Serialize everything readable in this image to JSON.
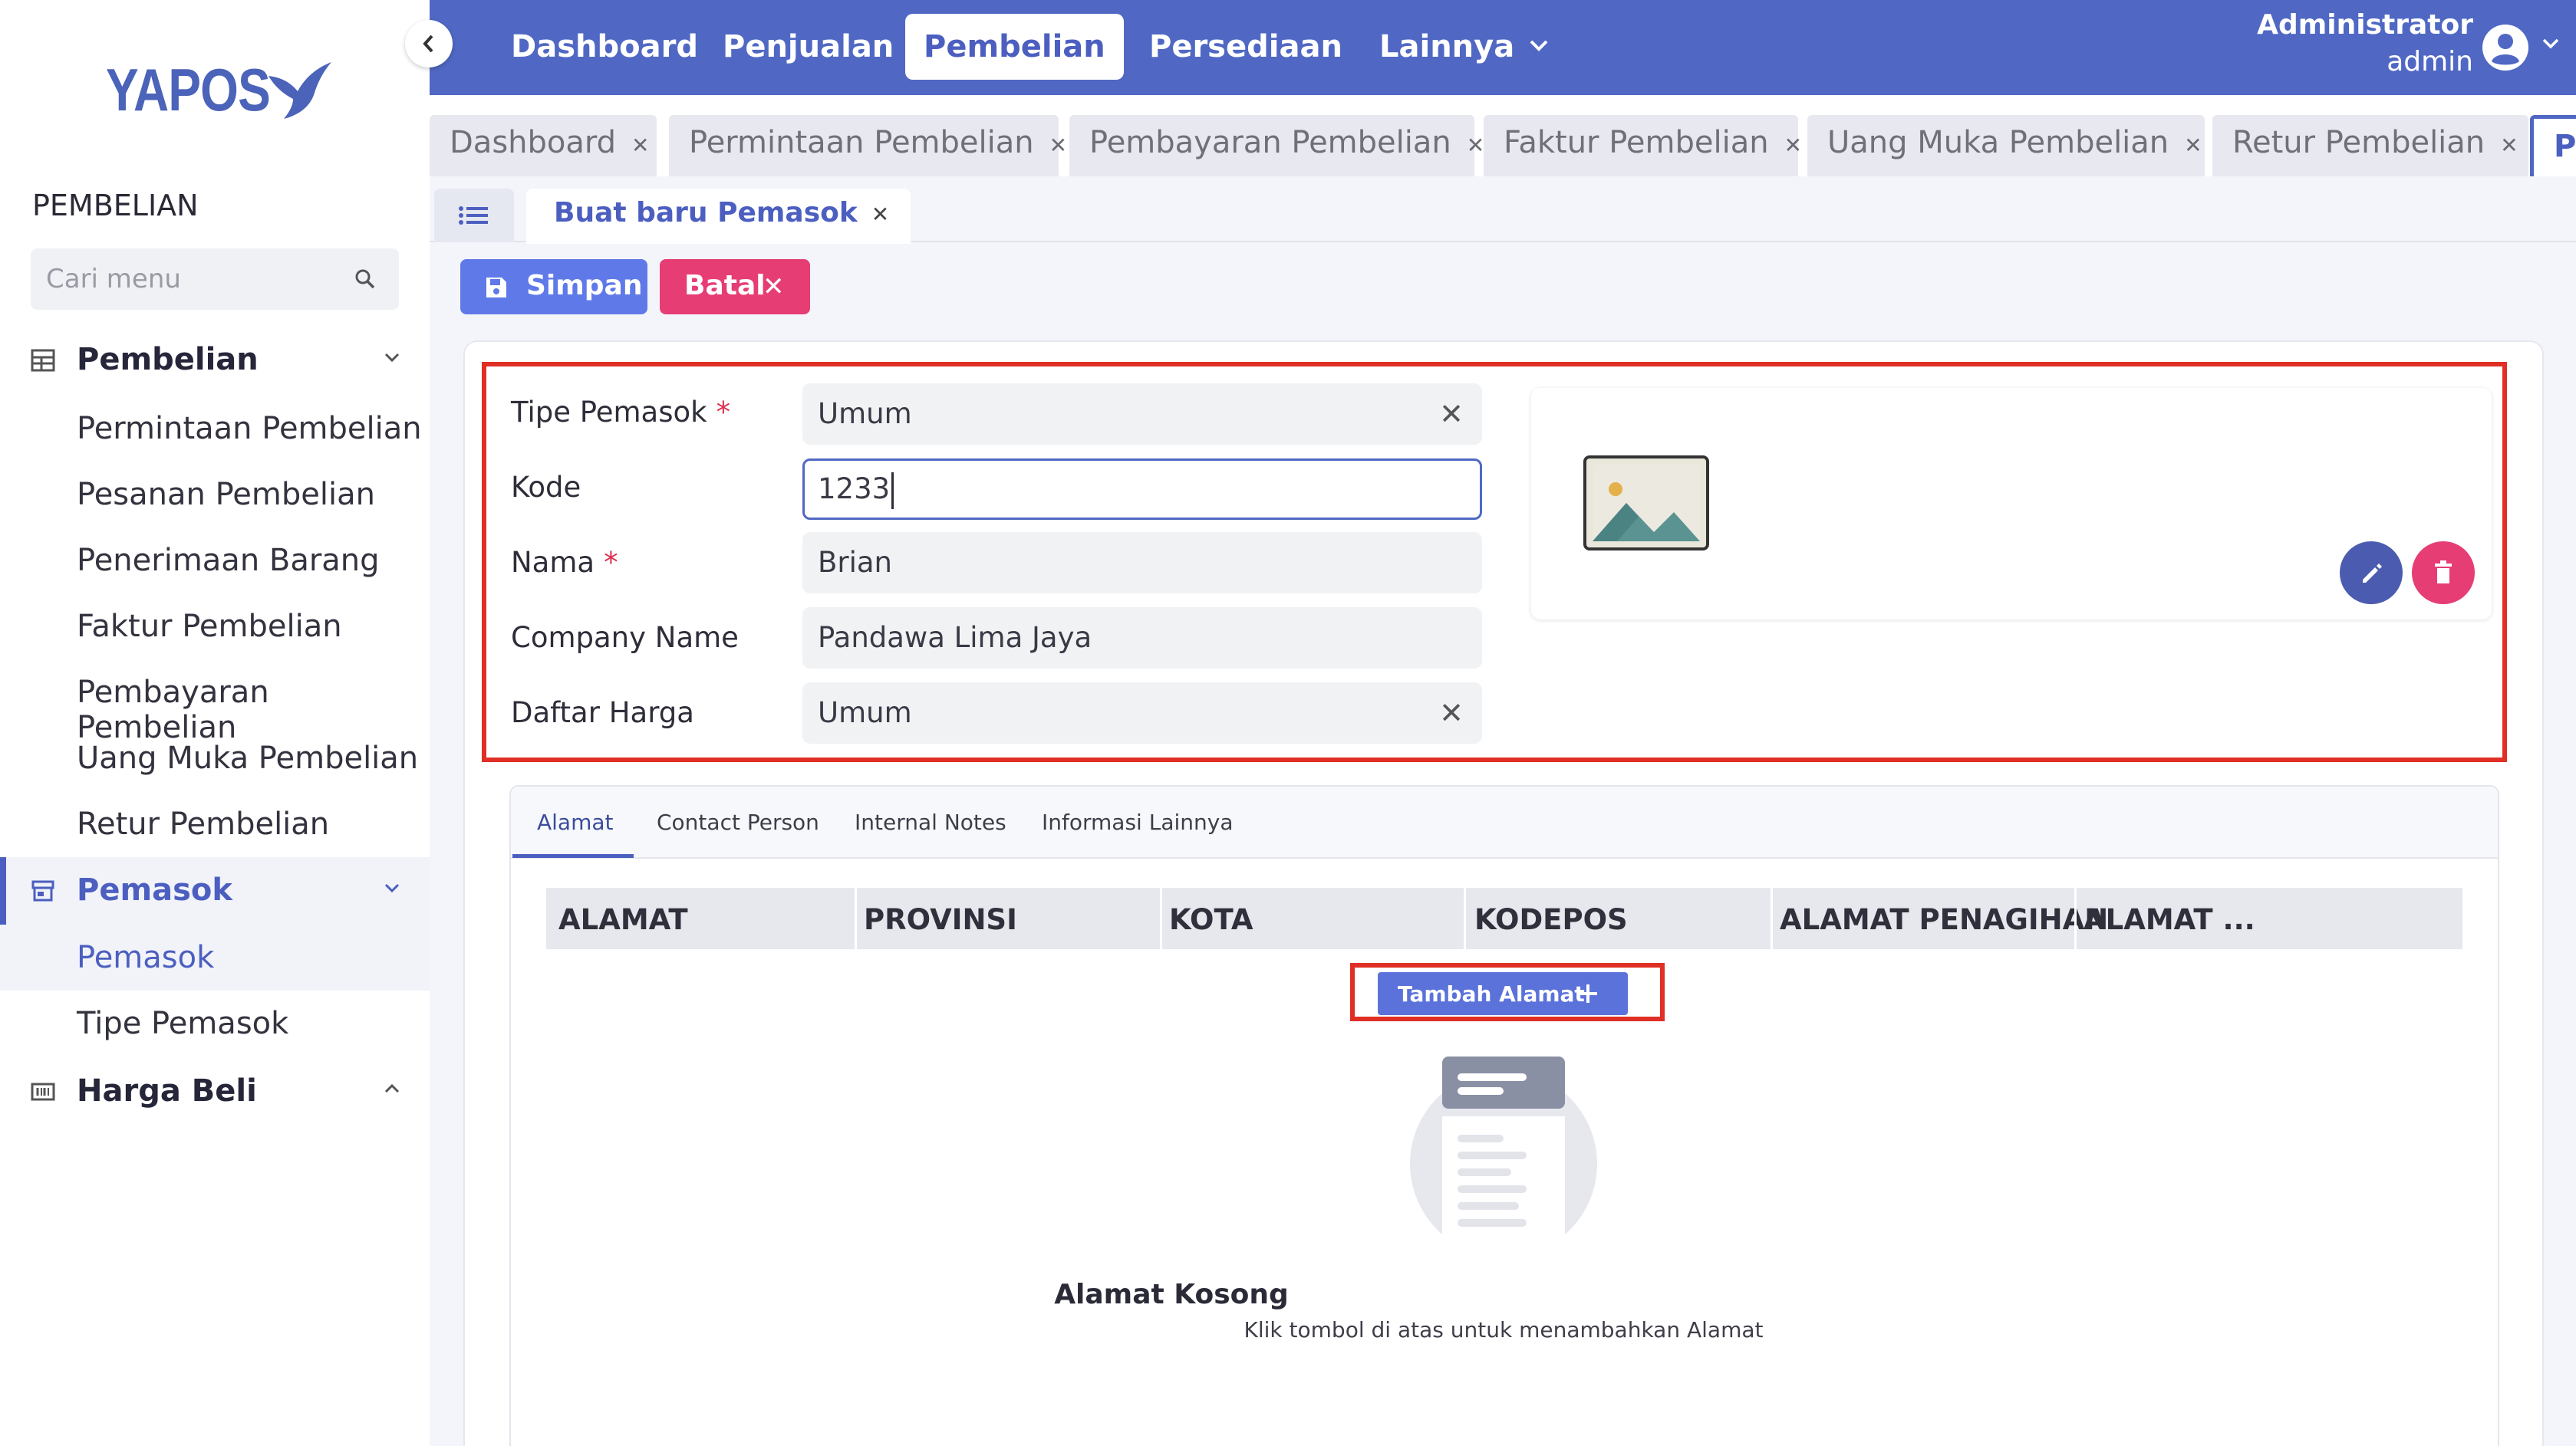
{
  "brand": {
    "name": "YAPOS"
  },
  "sidebar": {
    "section_title": "PEMBELIAN",
    "search_placeholder": "Cari menu",
    "groups": [
      {
        "label": "Pembelian",
        "icon": "table-icon",
        "expanded": true,
        "items": [
          "Permintaan Pembelian",
          "Pesanan Pembelian",
          "Penerimaan Barang",
          "Faktur Pembelian",
          "Pembayaran Pembelian",
          "Uang Muka Pembelian",
          "Retur Pembelian"
        ]
      },
      {
        "label": "Pemasok",
        "icon": "store-icon",
        "expanded": true,
        "items": [
          "Pemasok",
          "Tipe Pemasok"
        ]
      },
      {
        "label": "Harga Beli",
        "icon": "barcode-icon",
        "expanded": false,
        "items": []
      }
    ]
  },
  "topnav": {
    "items": [
      "Dashboard",
      "Penjualan",
      "Pembelian",
      "Persediaan",
      "Lainnya"
    ],
    "active": "Pembelian",
    "user_name": "Administrator",
    "user_role": "admin"
  },
  "doc_tabs": [
    "Dashboard",
    "Permintaan Pembelian",
    "Pembayaran Pembelian",
    "Faktur Pembelian",
    "Uang Muka Pembelian",
    "Retur Pembelian",
    "Pe"
  ],
  "subtab": {
    "label": "Buat baru Pemasok"
  },
  "actions": {
    "save": "Simpan",
    "cancel": "Batal"
  },
  "form": {
    "tipe_pemasok": {
      "label": "Tipe Pemasok",
      "value": "Umum",
      "required": "*"
    },
    "kode": {
      "label": "Kode",
      "value": "1233"
    },
    "nama": {
      "label": "Nama",
      "value": "Brian",
      "required": "*"
    },
    "company": {
      "label": "Company Name",
      "value": "Pandawa Lima Jaya"
    },
    "daftar_harga": {
      "label": "Daftar Harga",
      "value": "Umum"
    }
  },
  "detail_tabs": {
    "items": [
      "Alamat",
      "Contact Person",
      "Internal Notes",
      "Informasi Lainnya"
    ],
    "active": "Alamat"
  },
  "address_table": {
    "columns": [
      "ALAMAT",
      "PROVINSI",
      "KOTA",
      "KODEPOS",
      "ALAMAT PENAGIHAN",
      "ALAMAT ..."
    ],
    "add_button": "Tambah Alamat",
    "empty_title": "Alamat Kosong",
    "empty_subtitle": "Klik tombol di atas untuk menambahkan Alamat"
  },
  "colors": {
    "primary": "#5068c4",
    "danger": "#e63d74",
    "highlight": "#e02f24"
  }
}
